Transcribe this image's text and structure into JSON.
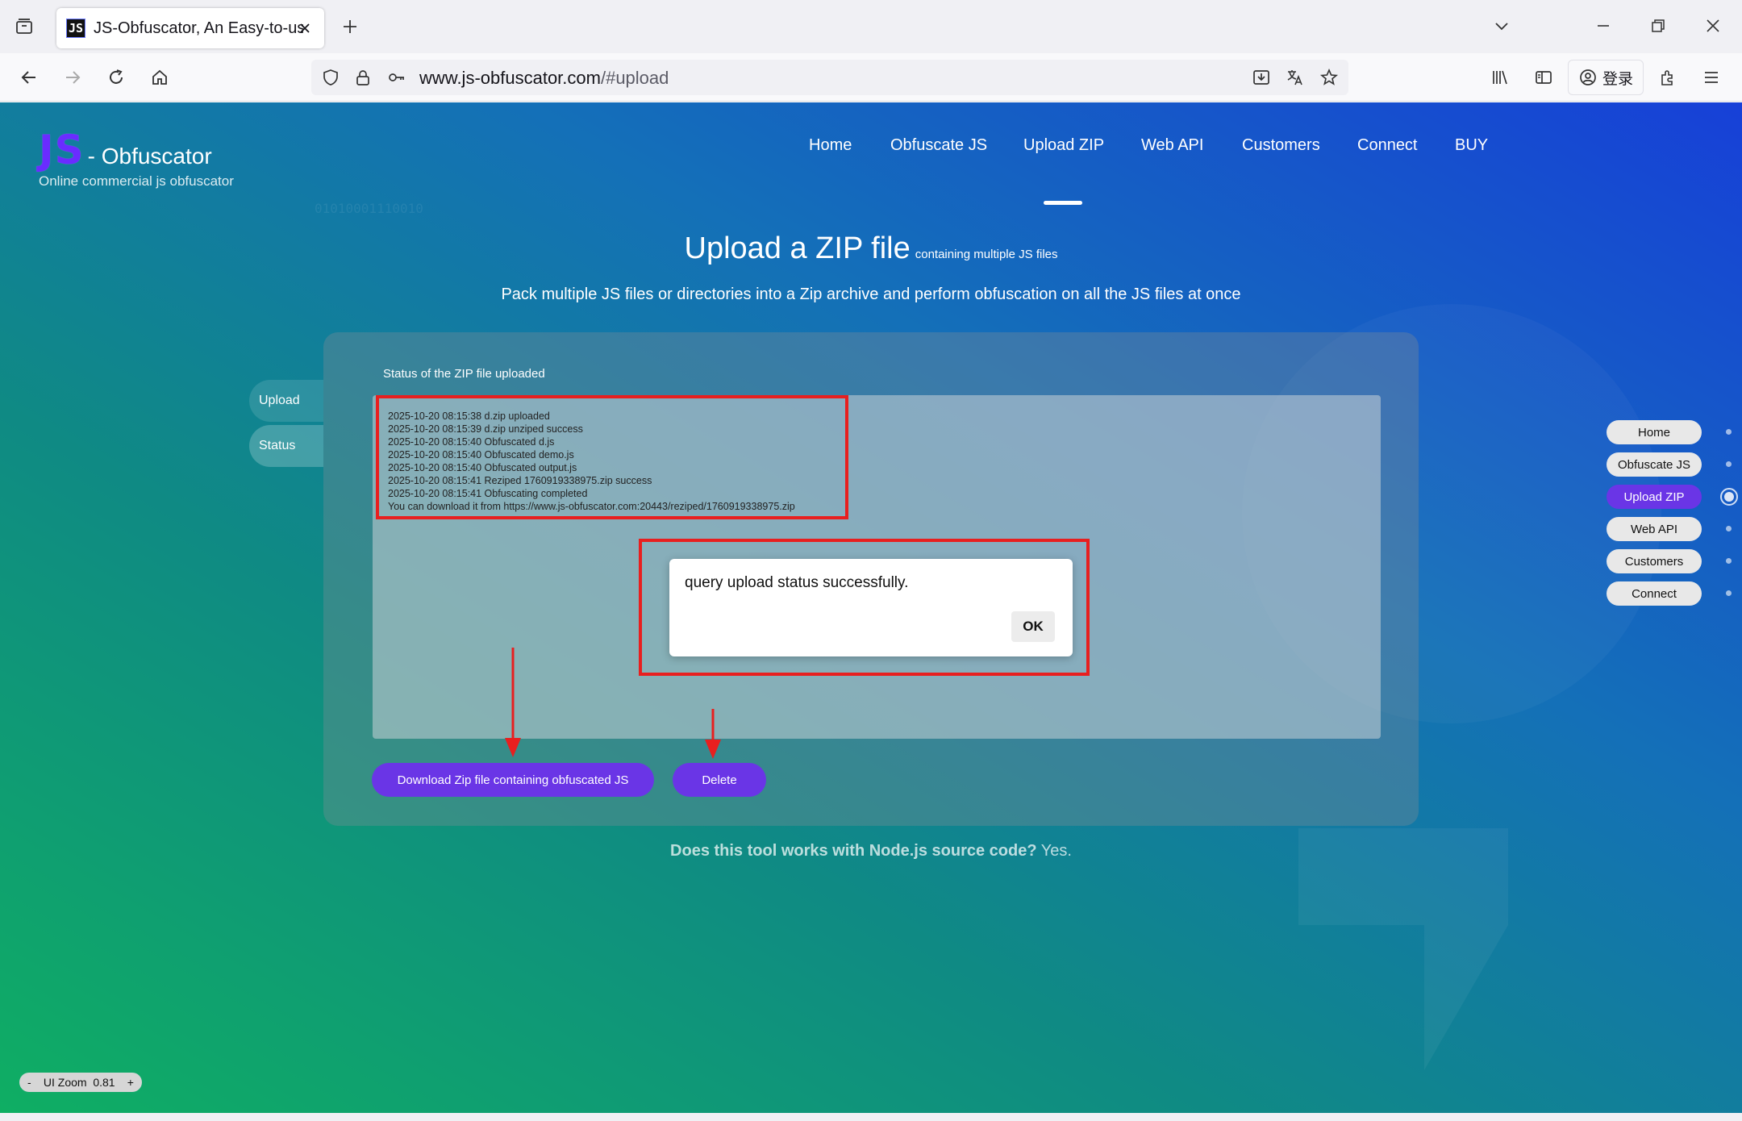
{
  "browser": {
    "tab_title": "JS-Obfuscator, An Easy-to-use",
    "favicon_text": "JS",
    "url_domain": "www.js-obfuscator.com",
    "url_path": "/#upload",
    "login_label": "登录"
  },
  "site": {
    "logo_js": "JS",
    "logo_name": "- Obfuscator",
    "logo_sub": "Online commercial js obfuscator",
    "bg_binary": "01010001110010"
  },
  "nav": {
    "items": [
      "Home",
      "Obfuscate JS",
      "Upload ZIP",
      "Web API",
      "Customers",
      "Connect",
      "BUY"
    ],
    "active": "Upload ZIP"
  },
  "heading": {
    "title": "Upload a ZIP file",
    "title_small": "containing multiple JS files",
    "subtitle": "Pack multiple JS files or directories into a Zip archive and perform obfuscation on all the JS files at once"
  },
  "side_tabs": [
    "Upload",
    "Status"
  ],
  "panel": {
    "label": "Status of the ZIP file uploaded",
    "log": [
      "2025-10-20 08:15:38 d.zip uploaded",
      "2025-10-20 08:15:39 d.zip unziped success",
      "2025-10-20 08:15:40 Obfuscated d.js",
      "2025-10-20 08:15:40 Obfuscated demo.js",
      "2025-10-20 08:15:40 Obfuscated output.js",
      "2025-10-20 08:15:41 Reziped 1760919338975.zip success",
      "2025-10-20 08:15:41 Obfuscating completed",
      "You can download it from https://www.js-obfuscator.com:20443/reziped/1760919338975.zip"
    ],
    "download_label": "Download Zip file containing obfuscated JS",
    "delete_label": "Delete"
  },
  "dialog": {
    "message": "query upload status successfully.",
    "ok_label": "OK"
  },
  "faq": {
    "question": "Does this tool works with Node.js source code?",
    "answer": "Yes."
  },
  "quicknav": {
    "items": [
      "Home",
      "Obfuscate JS",
      "Upload ZIP",
      "Web API",
      "Customers",
      "Connect"
    ],
    "active": "Upload ZIP"
  },
  "zoom": {
    "minus": "-",
    "label": "UI Zoom",
    "value": "0.81",
    "plus": "+"
  },
  "colors": {
    "accent": "#6a35e6",
    "highlight": "#e81f1f"
  }
}
